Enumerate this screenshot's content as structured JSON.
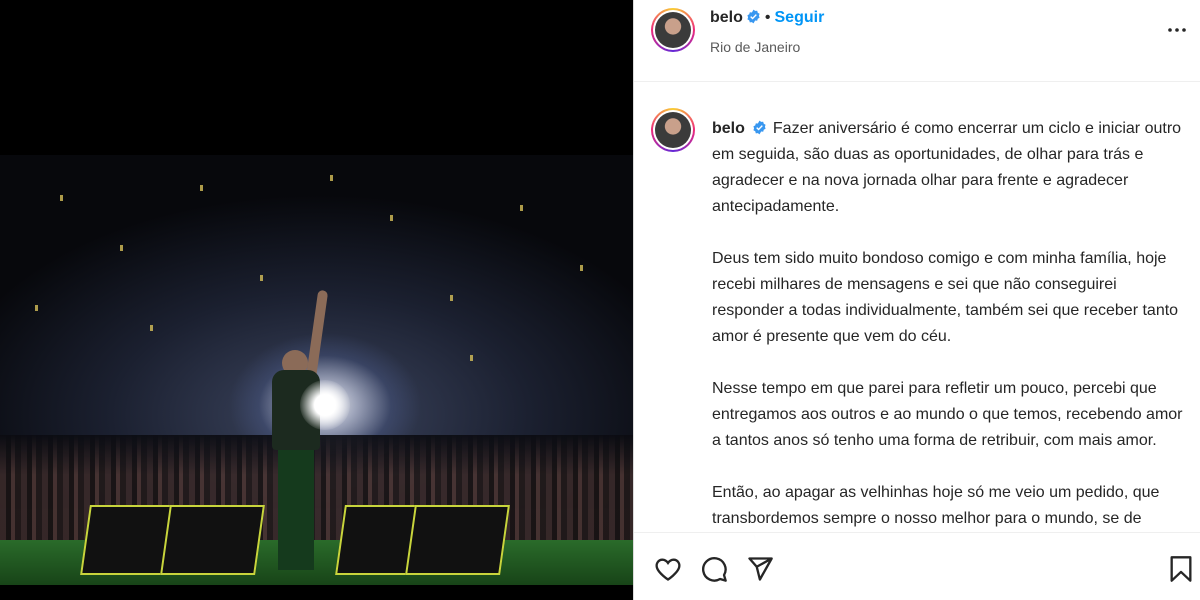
{
  "post": {
    "username": "belo",
    "follow_label": "Seguir",
    "separator": "•",
    "location": "Rio de Janeiro",
    "caption": {
      "username": "belo",
      "paragraphs": [
        "Fazer aniversário é como encerrar um ciclo e iniciar outro em seguida, são duas as oportunidades, de olhar para trás e agradecer e na nova jornada olhar para frente e agradecer antecipadamente.",
        "Deus tem sido muito bondoso comigo e com minha família, hoje recebi milhares de mensagens e sei que não conseguirei responder a todas individualmente, também sei que receber tanto amor é presente que vem do céu.",
        "Nesse tempo em que parei para refletir um pouco, percebi que entregamos aos outros e ao mundo o que temos, recebendo amor a tantos anos só tenho uma forma de retribuir, com mais amor.",
        "Então, ao apagar as velhinhas hoje só me veio um pedido, que transbordemos sempre o nosso melhor para o mundo, se de"
      ]
    }
  },
  "icons": {
    "verified": "verified-badge-icon",
    "more": "more-options-icon",
    "like": "heart-icon",
    "comment": "comment-icon",
    "share": "share-icon",
    "save": "bookmark-icon"
  },
  "colors": {
    "accent": "#0095f6",
    "verified": "#3897f0",
    "text": "#262626",
    "secondary": "#5a5a5a"
  }
}
